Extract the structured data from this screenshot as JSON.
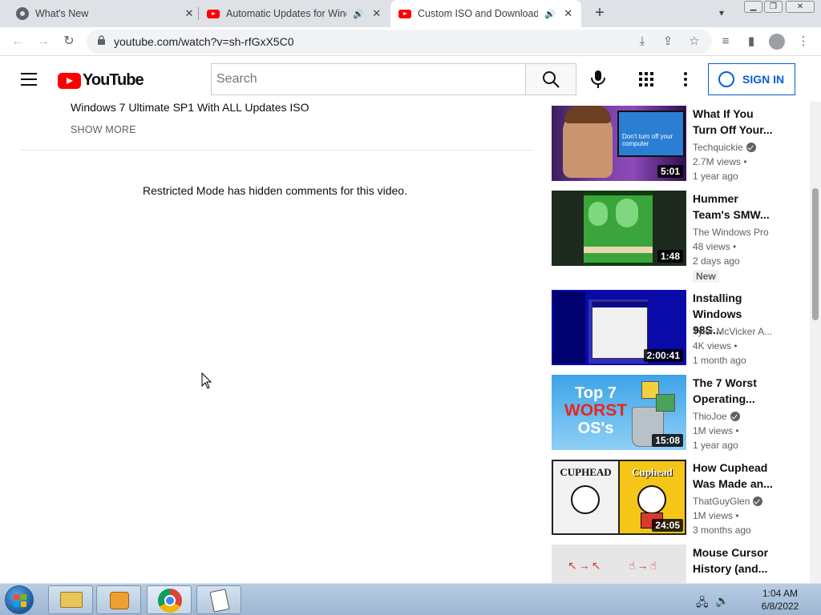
{
  "browser": {
    "tabs": [
      {
        "label": "What's New",
        "favicon": "chrome-icon",
        "active": false
      },
      {
        "label": "Automatic Updates for Wind",
        "favicon": "youtube-icon",
        "active": false,
        "audio": true
      },
      {
        "label": "Custom ISO and Download U",
        "favicon": "youtube-icon",
        "active": true,
        "audio": true
      }
    ],
    "url": "youtube.com/watch?v=sh-rfGxX5C0"
  },
  "youtube": {
    "logo_text": "YouTube",
    "search_placeholder": "Search",
    "sign_in_label": "SIGN IN"
  },
  "main": {
    "description_line": "Windows 7 Ultimate SP1 With ALL Updates ISO",
    "show_more_label": "SHOW MORE",
    "comments_notice": "Restricted Mode has hidden comments for this video."
  },
  "recommendations": [
    {
      "title": "What If You Turn Off Your...",
      "channel": "Techquickie",
      "verified": true,
      "views": "2.7M views •",
      "age": "1 year ago",
      "duration": "5:01",
      "thumb_text": "Don't turn off your computer"
    },
    {
      "title": "Hummer Team's SMW...",
      "channel": "The Windows Pro",
      "verified": false,
      "views": "48 views •",
      "age": "2 days ago",
      "duration": "1:48",
      "badge": "New"
    },
    {
      "title": "Installing Windows 98S...",
      "channel": "Tyler McVicker A...",
      "verified": false,
      "views": "4K views •",
      "age": "1 month ago",
      "duration": "2:00:41"
    },
    {
      "title": "The 7 Worst Operating...",
      "channel": "ThioJoe",
      "verified": true,
      "views": "1M views •",
      "age": "1 year ago",
      "duration": "15:08",
      "thumb_line1": "Top 7",
      "thumb_line2": "WORST",
      "thumb_line3": "OS's"
    },
    {
      "title": "How Cuphead Was Made an...",
      "channel": "ThatGuyGlen",
      "verified": true,
      "views": "1M views •",
      "age": "3 months ago",
      "duration": "24:05",
      "thumb_left": "CUPHEAD",
      "thumb_right": "Cuphead"
    },
    {
      "title": "Mouse Cursor History (and..."
    }
  ],
  "taskbar": {
    "time": "1:04 AM",
    "date": "6/8/2022"
  }
}
